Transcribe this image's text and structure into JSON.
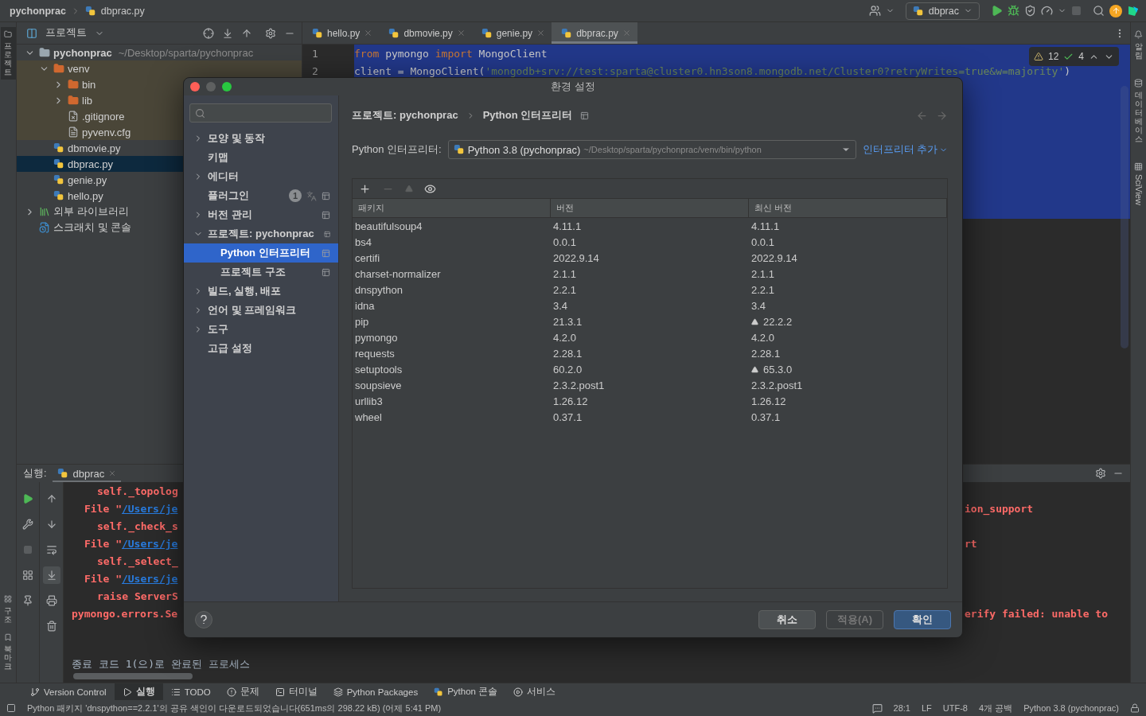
{
  "title_bar": {
    "project": "pychonprac",
    "file": "dbprac.py",
    "run_config": "dbprac"
  },
  "project_panel": {
    "title": "프로젝트",
    "tree": [
      {
        "label": "pychonprac",
        "hint": "~/Desktop/sparta/pychonprac",
        "kind": "root",
        "expanded": true,
        "selected": false,
        "children": [
          {
            "label": "venv",
            "kind": "excluded-folder",
            "expanded": true,
            "selected": false,
            "children": [
              {
                "label": "bin",
                "kind": "excluded-folder",
                "expanded": false,
                "selected": false
              },
              {
                "label": "lib",
                "kind": "excluded-folder",
                "expanded": false,
                "selected": false
              },
              {
                "label": ".gitignore",
                "kind": "ignore-file",
                "selected": false
              },
              {
                "label": "pyvenv.cfg",
                "kind": "config",
                "selected": false
              }
            ]
          },
          {
            "label": "dbmovie.py",
            "kind": "python",
            "selected": false
          },
          {
            "label": "dbprac.py",
            "kind": "python",
            "selected": true
          },
          {
            "label": "genie.py",
            "kind": "python",
            "selected": false
          },
          {
            "label": "hello.py",
            "kind": "python",
            "selected": false
          }
        ]
      },
      {
        "label": "외부 라이브러리",
        "kind": "library",
        "expanded": false,
        "selected": false
      },
      {
        "label": "스크래치 및 콘솔",
        "kind": "scratch",
        "selected": false
      }
    ]
  },
  "editor": {
    "tabs": [
      {
        "label": "hello.py",
        "selected": false
      },
      {
        "label": "dbmovie.py",
        "selected": false
      },
      {
        "label": "genie.py",
        "selected": false
      },
      {
        "label": "dbprac.py",
        "selected": true
      }
    ],
    "lines": [
      {
        "number": "1",
        "selected": true,
        "tokens": [
          {
            "kind": "keyword",
            "text": "from"
          },
          {
            "kind": "plain",
            "text": " pymongo "
          },
          {
            "kind": "keyword",
            "text": "import"
          },
          {
            "kind": "plain",
            "text": " MongoClient"
          }
        ]
      },
      {
        "number": "2",
        "selected": true,
        "tokens": [
          {
            "kind": "plain",
            "text": "client = MongoClient("
          },
          {
            "kind": "string",
            "text": "'mongodb+srv://test:sparta@cluster0.hn3son8.mongodb.net/Cluster0?retryWrites=true&w=majority'"
          },
          {
            "kind": "plain",
            "text": ")"
          }
        ]
      }
    ],
    "warnings": "12",
    "checks": "4"
  },
  "run_panel": {
    "label": "실행:",
    "tab": "dbprac",
    "console": [
      {
        "kind": "code",
        "left": "self._topolog"
      },
      {
        "kind": "file",
        "left": "File \"",
        "link": "/Users/je",
        "right": "ion_support"
      },
      {
        "kind": "code",
        "left": "self._check_s"
      },
      {
        "kind": "file",
        "left": "File \"",
        "link": "/Users/je",
        "right": "rt"
      },
      {
        "kind": "code",
        "left": "self._select_"
      },
      {
        "kind": "file",
        "left": "File \"",
        "link": "/Users/je"
      },
      {
        "kind": "code",
        "left": "raise ServerS"
      },
      {
        "kind": "error",
        "left": "pymongo.errors.Se",
        "right": "erify failed: unable to"
      },
      {
        "kind": "exit",
        "left": "종료 코드 1(으)로 완료된 프로세스"
      }
    ]
  },
  "tool_windows": [
    {
      "label": "Version Control",
      "kind": "vcs",
      "selected": false
    },
    {
      "label": "실행",
      "kind": "run",
      "selected": true
    },
    {
      "label": "TODO",
      "kind": "todo",
      "selected": false
    },
    {
      "label": "문제",
      "kind": "problems",
      "selected": false
    },
    {
      "label": "터미널",
      "kind": "terminal",
      "selected": false
    },
    {
      "label": "Python Packages",
      "kind": "packages",
      "selected": false
    },
    {
      "label": "Python 콘솔",
      "kind": "console",
      "selected": false
    },
    {
      "label": "서비스",
      "kind": "services",
      "selected": false
    }
  ],
  "side_tabs": {
    "left": [
      {
        "label": "프로젝트",
        "kind": "stacked",
        "selected": true
      },
      {
        "label": "구조",
        "kind": "stacked",
        "selected": false
      },
      {
        "label": "북마크",
        "kind": "stacked",
        "selected": false
      }
    ],
    "right": [
      {
        "label": "알림",
        "kind": "stacked",
        "selected": false
      },
      {
        "label": "데이터베이스",
        "kind": "stacked",
        "selected": false
      },
      {
        "label": "SciView",
        "kind": "rotated",
        "selected": false
      }
    ]
  },
  "status_bar": {
    "message": "Python 패키지 'dnspython==2.2.1'의 공유 색인이 다운로드되었습니다(651ms의 298.22 kB) (어제 5:41 PM)",
    "position": "28:1",
    "line_ending": "LF",
    "encoding": "UTF-8",
    "indent": "4개 공백",
    "interpreter": "Python 3.8 (pychonprac)"
  },
  "dialog": {
    "title": "환경 설정",
    "nav": [
      {
        "label": "모양 및 동작",
        "kind": "group",
        "expanded": false,
        "selected": false,
        "project_scoped": false
      },
      {
        "label": "키맵",
        "kind": "page",
        "selected": false,
        "project_scoped": false
      },
      {
        "label": "에디터",
        "kind": "group",
        "expanded": false,
        "selected": false,
        "project_scoped": false
      },
      {
        "label": "플러그인",
        "kind": "page",
        "selected": false,
        "project_scoped": true,
        "badge": "1"
      },
      {
        "label": "버전 관리",
        "kind": "group",
        "expanded": false,
        "selected": false,
        "project_scoped": true
      },
      {
        "label": "프로젝트: pychonprac",
        "kind": "group",
        "expanded": true,
        "selected": false,
        "project_scoped": true,
        "children": [
          {
            "label": "Python 인터프리터",
            "kind": "page",
            "selected": true,
            "project_scoped": true
          },
          {
            "label": "프로젝트 구조",
            "kind": "page",
            "selected": false,
            "project_scoped": true
          }
        ]
      },
      {
        "label": "빌드, 실행, 배포",
        "kind": "group",
        "expanded": false,
        "selected": false,
        "project_scoped": false
      },
      {
        "label": "언어 및 프레임워크",
        "kind": "group",
        "expanded": false,
        "selected": false,
        "project_scoped": false
      },
      {
        "label": "도구",
        "kind": "group",
        "expanded": false,
        "selected": false,
        "project_scoped": false
      },
      {
        "label": "고급 설정",
        "kind": "page",
        "selected": false,
        "project_scoped": false
      }
    ],
    "breadcrumb": [
      "프로젝트: pychonprac",
      "Python 인터프리터"
    ],
    "interpreter": {
      "label": "Python 인터프리터:",
      "value": "Python 3.8 (pychonprac)",
      "path": "~/Desktop/sparta/pychonprac/venv/bin/python",
      "add_link": "인터프리터 추가"
    },
    "table": {
      "columns": [
        "패키지",
        "버전",
        "최신 버전"
      ],
      "rows": [
        {
          "package": "beautifulsoup4",
          "version": "4.11.1",
          "latest": "4.11.1",
          "upgrade": false
        },
        {
          "package": "bs4",
          "version": "0.0.1",
          "latest": "0.0.1",
          "upgrade": false
        },
        {
          "package": "certifi",
          "version": "2022.9.14",
          "latest": "2022.9.14",
          "upgrade": false
        },
        {
          "package": "charset-normalizer",
          "version": "2.1.1",
          "latest": "2.1.1",
          "upgrade": false
        },
        {
          "package": "dnspython",
          "version": "2.2.1",
          "latest": "2.2.1",
          "upgrade": false
        },
        {
          "package": "idna",
          "version": "3.4",
          "latest": "3.4",
          "upgrade": false
        },
        {
          "package": "pip",
          "version": "21.3.1",
          "latest": "22.2.2",
          "upgrade": true
        },
        {
          "package": "pymongo",
          "version": "4.2.0",
          "latest": "4.2.0",
          "upgrade": false
        },
        {
          "package": "requests",
          "version": "2.28.1",
          "latest": "2.28.1",
          "upgrade": false
        },
        {
          "package": "setuptools",
          "version": "60.2.0",
          "latest": "65.3.0",
          "upgrade": true
        },
        {
          "package": "soupsieve",
          "version": "2.3.2.post1",
          "latest": "2.3.2.post1",
          "upgrade": false
        },
        {
          "package": "urllib3",
          "version": "1.26.12",
          "latest": "1.26.12",
          "upgrade": false
        },
        {
          "package": "wheel",
          "version": "0.37.1",
          "latest": "0.37.1",
          "upgrade": false
        }
      ]
    },
    "buttons": [
      {
        "label": "취소",
        "kind": "default",
        "disabled": false
      },
      {
        "label": "적용(A)",
        "kind": "default",
        "disabled": true
      },
      {
        "label": "확인",
        "kind": "primary",
        "disabled": false
      }
    ]
  }
}
